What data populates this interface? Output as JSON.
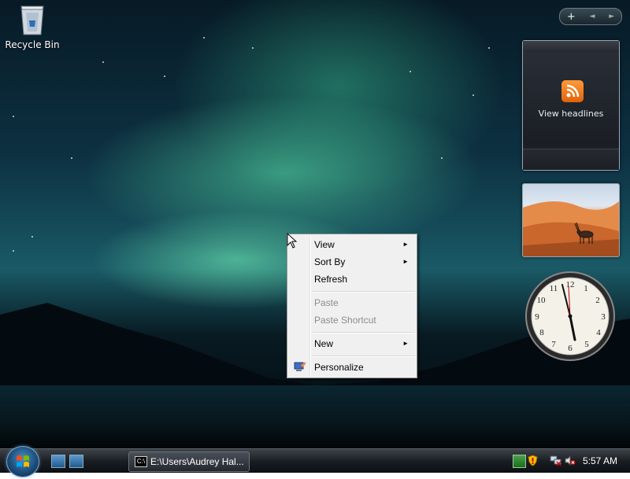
{
  "desktop": {
    "recycle_bin_label": "Recycle Bin"
  },
  "gadgets": {
    "feed_label": "View headlines",
    "sidebar_controls": {
      "add": "+",
      "prev": "◄",
      "next": "►"
    }
  },
  "context_menu": {
    "items": [
      {
        "label": "View",
        "submenu": true,
        "enabled": true
      },
      {
        "label": "Sort By",
        "submenu": true,
        "enabled": true
      },
      {
        "label": "Refresh",
        "submenu": false,
        "enabled": true
      },
      {
        "label": "Paste",
        "submenu": false,
        "enabled": false
      },
      {
        "label": "Paste Shortcut",
        "submenu": false,
        "enabled": false
      },
      {
        "label": "New",
        "submenu": true,
        "enabled": true
      },
      {
        "label": "Personalize",
        "submenu": false,
        "enabled": true,
        "icon": "personalize-icon"
      }
    ],
    "submenu_arrow": "►"
  },
  "taskbar": {
    "task_label": "E:\\Users\\Audrey Hal...",
    "task_icon_text": "C:\\",
    "clock_time": "5:57 AM"
  },
  "colors": {
    "menu_bg": "#f0f0f0",
    "disabled_text": "#8d8d8d",
    "rss_orange": "#f07c1e"
  }
}
